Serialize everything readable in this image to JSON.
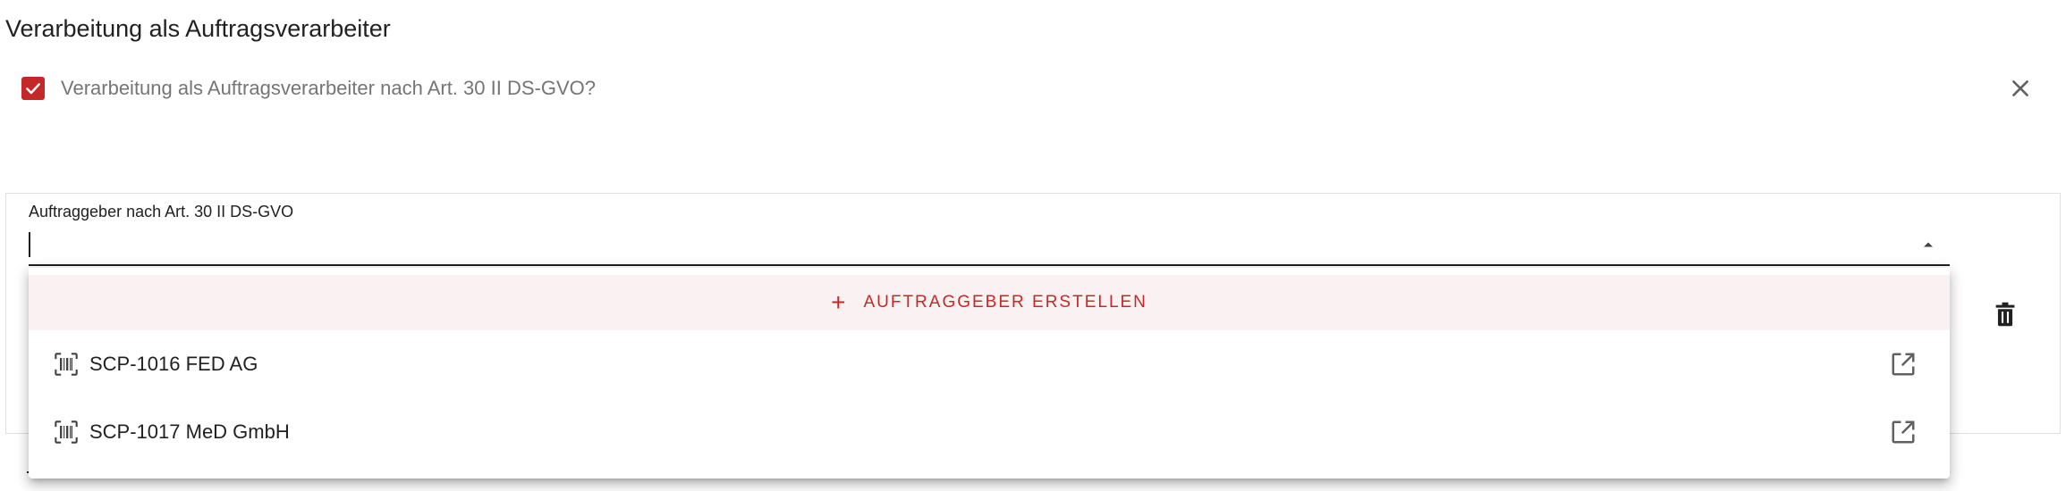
{
  "section": {
    "title": "Verarbeitung als Auftragsverarbeiter"
  },
  "checkbox": {
    "label": "Verarbeitung als Auftragsverarbeiter nach Art. 30 II DS-GVO?",
    "checked": true
  },
  "field": {
    "label": "Auftraggeber nach Art. 30 II DS-GVO",
    "value": ""
  },
  "dropdown": {
    "create_label": "AUFTRAGGEBER ERSTELLEN",
    "options": [
      {
        "label": "SCP-1016 FED AG",
        "icon": "barcode-scan-icon",
        "action_icon": "open-in-new-icon"
      },
      {
        "label": "SCP-1017 MeD GmbH",
        "icon": "barcode-scan-icon",
        "action_icon": "open-in-new-icon"
      }
    ]
  },
  "colors": {
    "accent": "#c62828",
    "create_background": "#faf2f2",
    "muted_text": "#757575"
  },
  "icons": {
    "checkbox": "check-icon",
    "close": "close-icon",
    "dropdown": "arrow-up-icon",
    "delete": "trash-icon",
    "create": "plus-icon"
  }
}
